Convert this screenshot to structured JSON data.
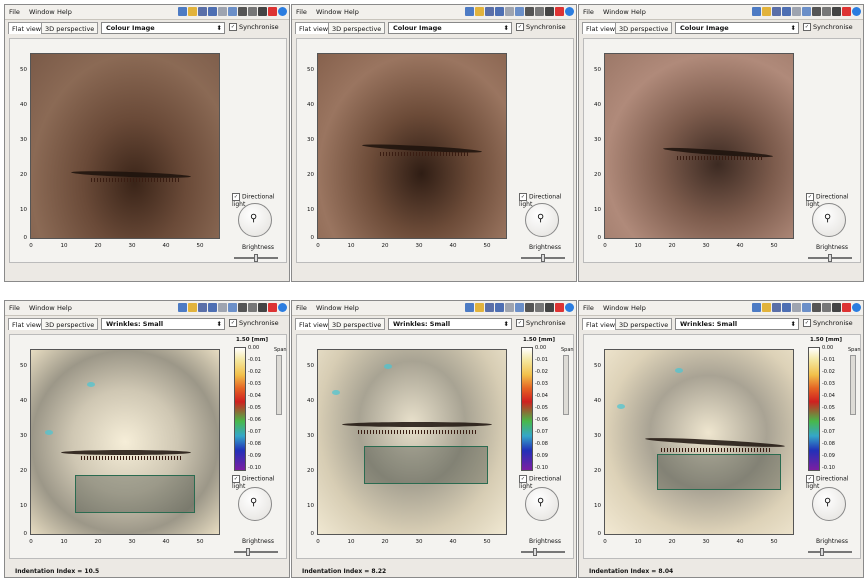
{
  "menu": {
    "file": "File",
    "window": "Window",
    "help": "Help"
  },
  "tabs": {
    "flat": "Flat view",
    "persp": "3D perspective"
  },
  "sync_label": "Synchronise",
  "directional_light": "Directional light",
  "brightness": "Brightness",
  "units": "1.50  [mm]",
  "span_label": "Span",
  "y_ticks": [
    "50",
    "40",
    "30",
    "20",
    "10",
    "0"
  ],
  "x_ticks": [
    "0",
    "10",
    "20",
    "30",
    "40",
    "50"
  ],
  "colorbar_ticks": [
    "0.00",
    "-0.01",
    "-0.02",
    "-0.03",
    "-0.04",
    "-0.05",
    "-0.06",
    "-0.07",
    "-0.08",
    "-0.09",
    "-0.10"
  ],
  "panels": [
    {
      "mode": "Colour Image",
      "status": ""
    },
    {
      "mode": "Colour Image",
      "status": ""
    },
    {
      "mode": "Colour Image",
      "status": ""
    },
    {
      "mode": "Wrinkles: Small",
      "status": "Indentation Index = 10.5"
    },
    {
      "mode": "Wrinkles: Small",
      "status": "Indentation Index = 8.22"
    },
    {
      "mode": "Wrinkles: Small",
      "status": "Indentation Index = 8.04"
    }
  ],
  "colors": {
    "accent": "#2a6b50",
    "background": "#ece9e4"
  }
}
